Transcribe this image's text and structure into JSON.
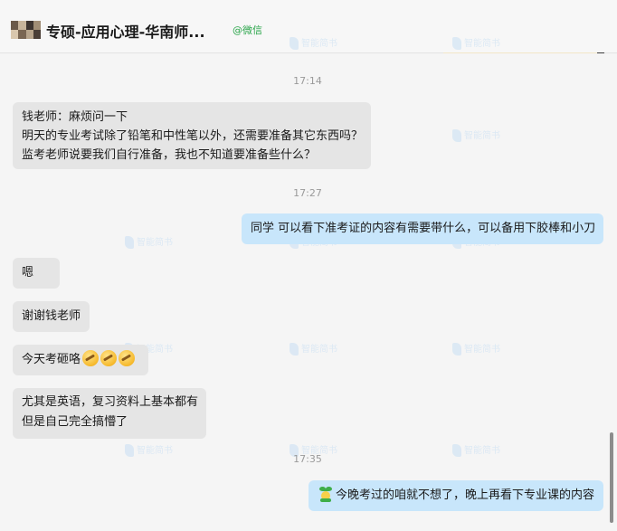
{
  "header": {
    "title": "专硕-应用心理-华南师...",
    "source_tag": "@微信"
  },
  "watermark_text": "智能简书",
  "messages": [
    {
      "kind": "time",
      "text": "17:14"
    },
    {
      "kind": "in",
      "lines": [
        "钱老师：麻烦问一下",
        "明天的专业考试除了铅笔和中性笔以外，还需要准备其它东西吗？",
        "监考老师说要我们自行准备，我也不知道要准备些什么？"
      ]
    },
    {
      "kind": "time",
      "text": "17:27"
    },
    {
      "kind": "out",
      "lines": [
        "同学 可以看下准考证的内容有需要带什么，可以备用下胶棒和小刀"
      ]
    },
    {
      "kind": "in",
      "lines": [
        "嗯"
      ]
    },
    {
      "kind": "in",
      "lines": [
        "谢谢钱老师"
      ]
    },
    {
      "kind": "in",
      "lines": [
        "今天考砸咯"
      ],
      "emoji": [
        "facepalm-emoji",
        "facepalm-emoji",
        "facepalm-emoji"
      ]
    },
    {
      "kind": "in",
      "lines": [
        "尤其是英语，复习资料上基本都有",
        "但是自己完全搞懵了"
      ]
    },
    {
      "kind": "time",
      "text": "17:35"
    },
    {
      "kind": "out",
      "lines": [
        "今晚考过的咱就不想了，晚上再看下专业课的内容"
      ],
      "emoji_prefix": "sprout-emoji"
    }
  ],
  "colors": {
    "incoming_bubble": "#e5e5e5",
    "outgoing_bubble": "#c8e6fb",
    "wechat_green": "#2aa54a"
  }
}
